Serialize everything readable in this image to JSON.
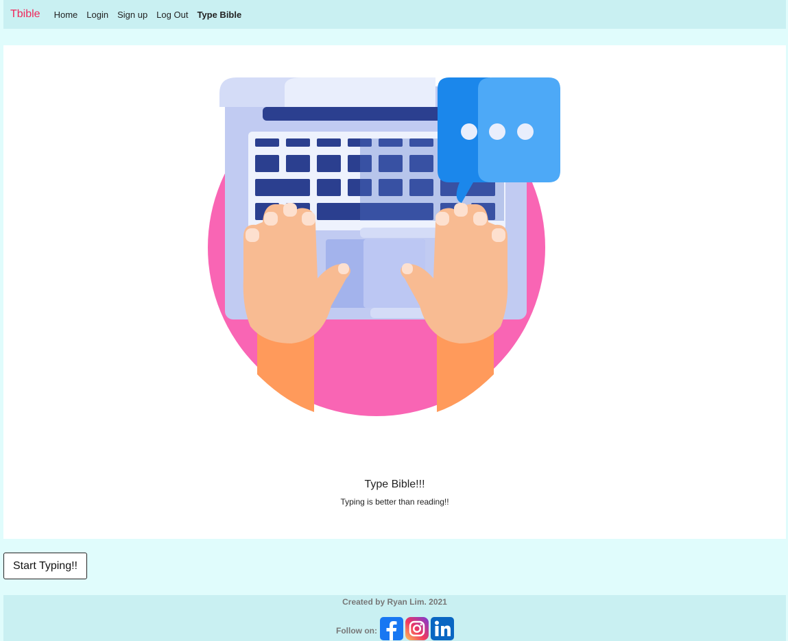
{
  "nav": {
    "brand": "Tbible",
    "links": [
      "Home",
      "Login",
      "Sign up",
      "Log Out",
      "Type Bible"
    ],
    "active": "Type Bible"
  },
  "hero": {
    "title": "Type Bible!!!",
    "subtitle": "Typing is better than reading!!",
    "illustration_icon": "hands-typing-on-laptop-illustration"
  },
  "actions": {
    "start_label": "Start Typing!!"
  },
  "footer": {
    "credit": "Created by Ryan Lim. 2021",
    "follow_label": "Follow on:",
    "social_icons": [
      "facebook-icon",
      "instagram-icon",
      "linkedin-icon"
    ]
  },
  "colors": {
    "navbar_bg": "#c9f0f2",
    "page_bg": "#e0fcfc",
    "brand": "#f0265a",
    "circle": "#f965b4"
  }
}
